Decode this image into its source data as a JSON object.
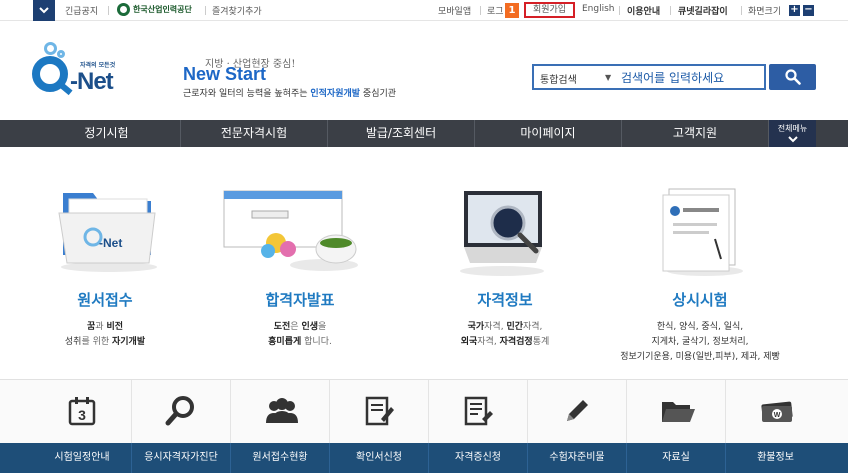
{
  "topbar": {
    "notice": "긴급공지",
    "org": "한국산업인력공단",
    "favorites": "즐겨찾기추가",
    "mobile": "모바일앱",
    "login": "로그",
    "badge": "1",
    "join": "회원가입",
    "english": "English",
    "guide": "이용안내",
    "helper": "큐넷길라잡이",
    "zoom": "화면크기",
    "zoom_in": "+",
    "zoom_out": "−"
  },
  "brand": {
    "sub": "자격의 모든것",
    "name": "-Net"
  },
  "slogan": {
    "small": "지방 · 산업현장 중심!",
    "big": "New Start",
    "desc_pre": "근로자와 일터의 능력을 높혀주는 ",
    "desc_hl": "인적자원개발",
    "desc_post": " 중심기관"
  },
  "search": {
    "select": "통합검색",
    "placeholder": "검색어를 입력하세요"
  },
  "nav": {
    "items": [
      "정기시험",
      "전문자격시험",
      "발급/조회센터",
      "마이페이지",
      "고객지원"
    ],
    "all_menu": "전체메뉴"
  },
  "features": [
    {
      "title": "원서접수",
      "line1": [
        {
          "t": "꿈",
          "b": true
        },
        {
          "t": "과 ",
          "b": false
        },
        {
          "t": "비전",
          "b": true
        }
      ],
      "line2": [
        {
          "t": "성취",
          "b": true
        },
        {
          "t": "를 위한 ",
          "b": false
        },
        {
          "t": "자기개발",
          "b": true
        }
      ]
    },
    {
      "title": "합격자발표",
      "line1": [
        {
          "t": "도전",
          "b": true
        },
        {
          "t": "은 ",
          "b": false
        },
        {
          "t": "인생",
          "b": true
        },
        {
          "t": "을",
          "b": false
        }
      ],
      "line2": [
        {
          "t": "흥미롭게",
          "b": true
        },
        {
          "t": " 합니다.",
          "b": false
        }
      ]
    },
    {
      "title": "자격정보",
      "line1": [
        {
          "t": "국가",
          "b": true
        },
        {
          "t": "자격, ",
          "b": false
        },
        {
          "t": "민간",
          "b": true
        },
        {
          "t": "자격,",
          "b": false
        }
      ],
      "line2": [
        {
          "t": "외국",
          "b": true
        },
        {
          "t": "자격, ",
          "b": false
        },
        {
          "t": "자격검정",
          "b": true
        },
        {
          "t": "통계",
          "b": false
        }
      ]
    },
    {
      "title": "상시시험",
      "line1": [
        {
          "t": "한식, 양식, 중식, 일식,",
          "b": true
        }
      ],
      "line2": [
        {
          "t": "지게차, 굴삭기, 정보처리,",
          "b": true
        }
      ],
      "line3": [
        {
          "t": "정보기기운용, 미용(일반,피부), 제과, 제빵",
          "b": true
        }
      ]
    }
  ],
  "quick": {
    "calendar_day": "3",
    "labels": [
      "시험일정안내",
      "응시자격자가진단",
      "원서접수현황",
      "확인서신청",
      "자격증신청",
      "수험자준비물",
      "자료실",
      "환불정보"
    ]
  },
  "colors": {
    "navy": "#1d3f72",
    "accent_blue": "#1f7ac1",
    "nav_bg": "#3b3f46",
    "bottom_bar": "#1e4e78",
    "join_outline": "#d51f26",
    "badge": "#f36c21"
  }
}
